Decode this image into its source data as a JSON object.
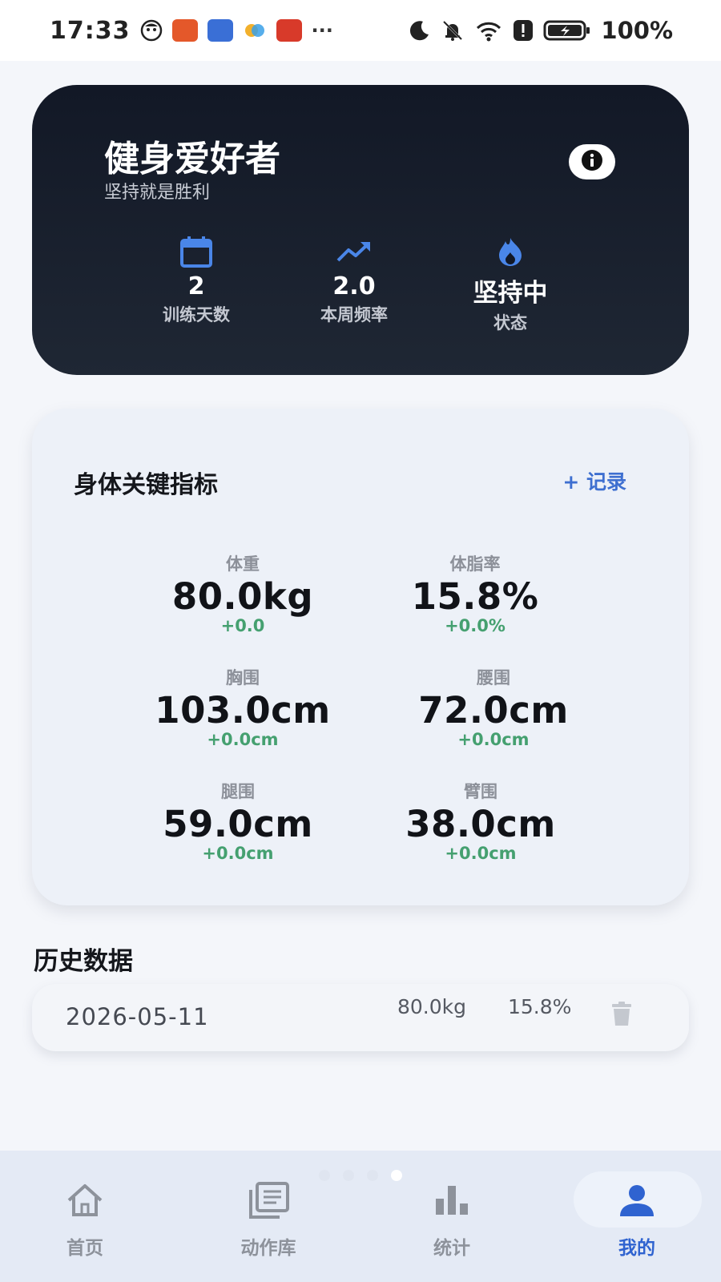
{
  "status_bar": {
    "time": "17:33",
    "battery": "100%",
    "more": "···"
  },
  "profile": {
    "title": "健身爱好者",
    "subtitle": "坚持就是胜利",
    "stats": [
      {
        "icon": "calendar-icon",
        "value": "2",
        "label": "训练天数"
      },
      {
        "icon": "trending-up-icon",
        "value": "2.0",
        "label": "本周频率"
      },
      {
        "icon": "flame-icon",
        "value": "坚持中",
        "label": "状态"
      }
    ]
  },
  "metrics": {
    "title": "身体关键指标",
    "add_label": "+ 记录",
    "items": [
      {
        "label": "体重",
        "value": "80.0kg",
        "delta": "+0.0"
      },
      {
        "label": "体脂率",
        "value": "15.8%",
        "delta": "+0.0%"
      },
      {
        "label": "胸围",
        "value": "103.0cm",
        "delta": "+0.0cm"
      },
      {
        "label": "腰围",
        "value": "72.0cm",
        "delta": "+0.0cm"
      },
      {
        "label": "腿围",
        "value": "59.0cm",
        "delta": "+0.0cm"
      },
      {
        "label": "臂围",
        "value": "38.0cm",
        "delta": "+0.0cm"
      }
    ]
  },
  "history": {
    "title": "历史数据",
    "rows": [
      {
        "date": "2026-05-11",
        "weight": "80.0kg",
        "body_fat": "15.8%"
      }
    ]
  },
  "nav": {
    "items": [
      {
        "label": "首页",
        "icon": "home-icon"
      },
      {
        "label": "动作库",
        "icon": "library-icon"
      },
      {
        "label": "统计",
        "icon": "bar-chart-icon"
      },
      {
        "label": "我的",
        "icon": "person-icon"
      }
    ],
    "active_index": 3
  },
  "colors": {
    "accent": "#2f63d0",
    "positive": "#45a070",
    "hero_bg": "#161d2b"
  }
}
